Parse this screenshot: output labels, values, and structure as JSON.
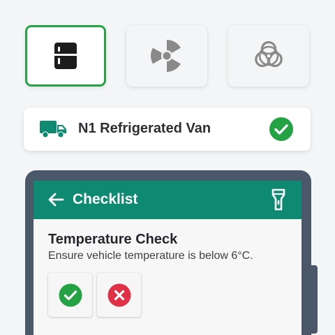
{
  "categories": [
    {
      "icon": "refrigerator-icon",
      "selected": true
    },
    {
      "icon": "radiation-icon",
      "selected": false
    },
    {
      "icon": "biohazard-icon",
      "selected": false
    }
  ],
  "vehicle": {
    "icon": "truck-icon",
    "name": "N1 Refrigerated Van",
    "status_icon": "check-circle-icon"
  },
  "checklist": {
    "title": "Checklist",
    "back_icon": "arrow-left-icon",
    "action_icon": "flashlight-icon",
    "item": {
      "title": "Temperature Check",
      "description": "Ensure vehicle temperature is below 6°C."
    }
  },
  "colors": {
    "accent_green": "#25a244",
    "header_teal": "#0e8a73",
    "reject_red": "#e03146",
    "device_frame": "#4a5869"
  }
}
